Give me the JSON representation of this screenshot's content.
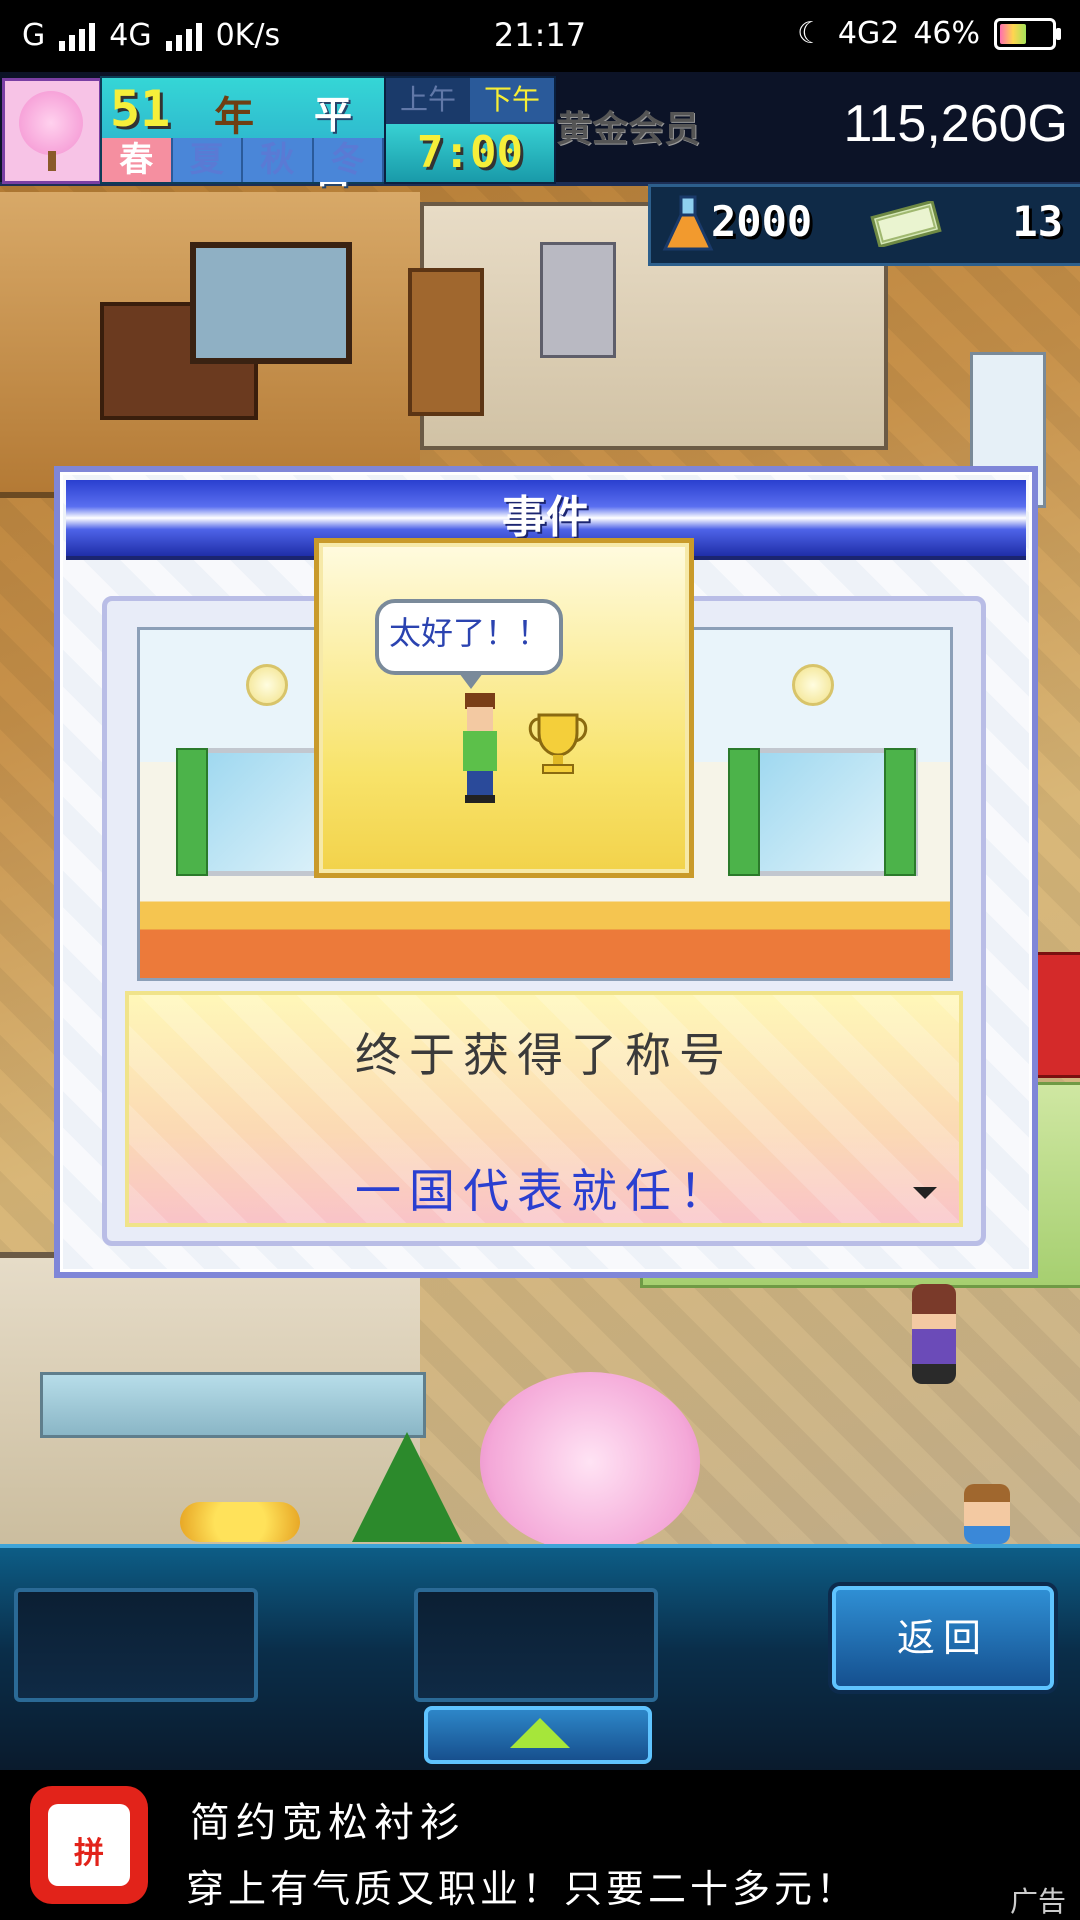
{
  "status_bar": {
    "carrier": "G",
    "network": "4G",
    "speed": "0K/s",
    "time": "21:17",
    "network2": "4G2",
    "battery": "46%"
  },
  "hud": {
    "year_num": "51",
    "year_unit": "年",
    "weekday": "平日",
    "seasons": [
      "春",
      "夏",
      "秋",
      "冬"
    ],
    "ampm": [
      "上午",
      "下午"
    ],
    "clock": "7:00",
    "gold_label": "黄金会员",
    "money": "115,260G",
    "research": "2000",
    "count": "13"
  },
  "dialog": {
    "title": "事件",
    "speech": "太好了！！",
    "line1": "终于获得了称号",
    "line2": "一国代表就任！"
  },
  "panel": {
    "back": "返回"
  },
  "ad": {
    "logo": "拼",
    "title": "简约宽松衬衫",
    "desc": "穿上有气质又职业！只要二十多元！",
    "tag": "广告"
  }
}
